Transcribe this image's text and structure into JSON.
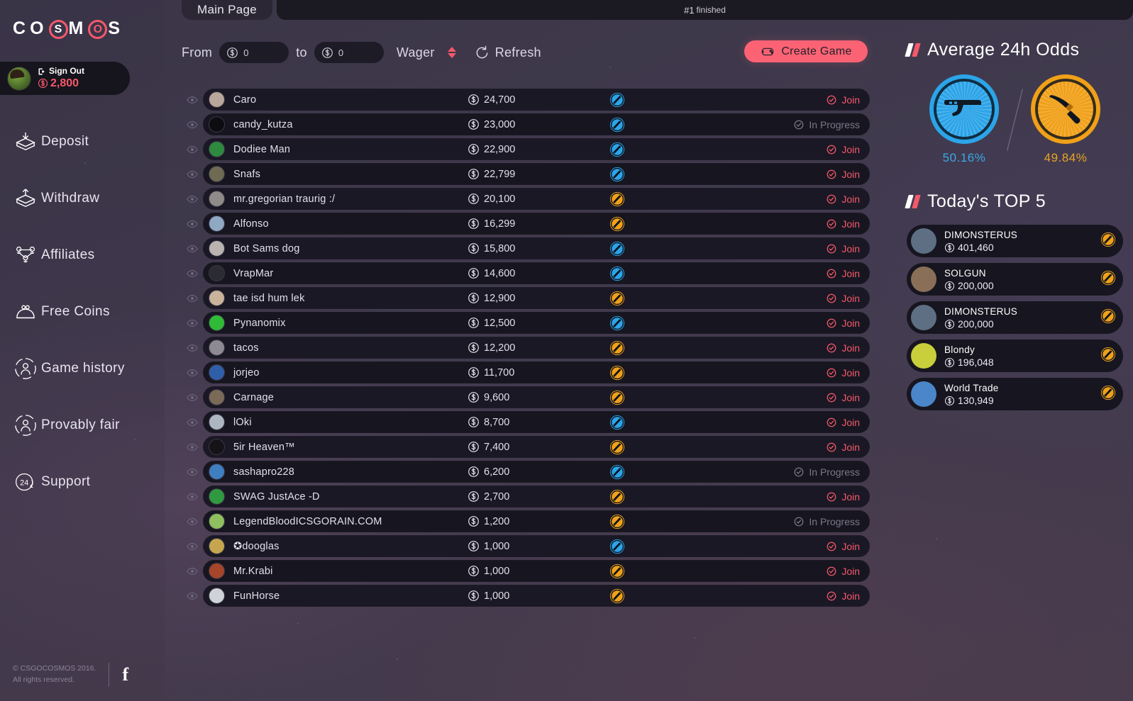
{
  "brand": {
    "name_parts": [
      "C",
      "O",
      "S",
      "M",
      "O",
      "S"
    ],
    "accent": "#f4596b"
  },
  "user": {
    "signout_label": "Sign Out",
    "balance": "2,800"
  },
  "sidebar": {
    "items": [
      {
        "label": "Deposit",
        "icon": "deposit-icon"
      },
      {
        "label": "Withdraw",
        "icon": "withdraw-icon"
      },
      {
        "label": "Affiliates",
        "icon": "affiliates-icon"
      },
      {
        "label": "Free Coins",
        "icon": "free-coins-icon"
      },
      {
        "label": "Game history",
        "icon": "game-history-icon"
      },
      {
        "label": "Provably fair",
        "icon": "provably-fair-icon"
      },
      {
        "label": "Support",
        "icon": "support-24-icon"
      }
    ],
    "footer_line1": "© CSGOCOSMOS 2016.",
    "footer_line2": "All rights reserved.",
    "facebook": "f"
  },
  "tabs": {
    "main_label": "Main Page",
    "status_number": "#1",
    "status_text": "finished"
  },
  "filters": {
    "from_label": "From",
    "from_value": "0",
    "to_label": "to",
    "to_value": "0",
    "wager_label": "Wager",
    "refresh_label": "Refresh",
    "create_game_label": "Create Game"
  },
  "games": [
    {
      "name": "Caro",
      "amount": "24,700",
      "side": "t",
      "action": "Join",
      "state": "join",
      "avatar": "#b8a79a"
    },
    {
      "name": "candy_kutza",
      "amount": "23,000",
      "side": "t",
      "action": "In Progress",
      "state": "progress",
      "avatar": "#0d0d11"
    },
    {
      "name": "Dodiee Man",
      "amount": "22,900",
      "side": "t",
      "action": "Join",
      "state": "join",
      "avatar": "#2d8a3e"
    },
    {
      "name": "Snafs",
      "amount": "22,799",
      "side": "t",
      "action": "Join",
      "state": "join",
      "avatar": "#6f6a52"
    },
    {
      "name": "mr.gregorian traurig :/",
      "amount": "20,100",
      "side": "ct",
      "action": "Join",
      "state": "join",
      "avatar": "#8e8b88"
    },
    {
      "name": "Alfonso",
      "amount": "16,299",
      "side": "ct",
      "action": "Join",
      "state": "join",
      "avatar": "#8fa8c4"
    },
    {
      "name": "Bot Sams dog",
      "amount": "15,800",
      "side": "t",
      "action": "Join",
      "state": "join",
      "avatar": "#b9b4b0"
    },
    {
      "name": "VrapMar",
      "amount": "14,600",
      "side": "t",
      "action": "Join",
      "state": "join",
      "avatar": "#2b2b33"
    },
    {
      "name": "tae isd hum lek",
      "amount": "12,900",
      "side": "ct",
      "action": "Join",
      "state": "join",
      "avatar": "#c9b39b"
    },
    {
      "name": "Pynanomix",
      "amount": "12,500",
      "side": "t",
      "action": "Join",
      "state": "join",
      "avatar": "#2fbb37"
    },
    {
      "name": "tacos",
      "amount": "12,200",
      "side": "ct",
      "action": "Join",
      "state": "join",
      "avatar": "#8d8a92"
    },
    {
      "name": "jorjeo",
      "amount": "11,700",
      "side": "ct",
      "action": "Join",
      "state": "join",
      "avatar": "#2f5fa8"
    },
    {
      "name": "Carnage",
      "amount": "9,600",
      "side": "ct",
      "action": "Join",
      "state": "join",
      "avatar": "#7b6a58"
    },
    {
      "name": "lOki",
      "amount": "8,700",
      "side": "t",
      "action": "Join",
      "state": "join",
      "avatar": "#aeb6c2"
    },
    {
      "name": "5ir Heaven™",
      "amount": "7,400",
      "side": "ct",
      "action": "Join",
      "state": "join",
      "avatar": "#151318"
    },
    {
      "name": "sashapro228",
      "amount": "6,200",
      "side": "t",
      "action": "In Progress",
      "state": "progress",
      "avatar": "#3f7fbf"
    },
    {
      "name": "SWAG JustAce -D",
      "amount": "2,700",
      "side": "ct",
      "action": "Join",
      "state": "join",
      "avatar": "#2f9a3f"
    },
    {
      "name": "LegendBloodICSGORAIN.COM",
      "amount": "1,200",
      "side": "ct",
      "action": "In Progress",
      "state": "progress",
      "avatar": "#8fbf5f"
    },
    {
      "name": "✪dooglas",
      "amount": "1,000",
      "side": "t",
      "action": "Join",
      "state": "join",
      "avatar": "#c5a64e"
    },
    {
      "name": "Mr.Krabi",
      "amount": "1,000",
      "side": "ct",
      "action": "Join",
      "state": "join",
      "avatar": "#a5452a"
    },
    {
      "name": "FunHorse",
      "amount": "1,000",
      "side": "ct",
      "action": "Join",
      "state": "join",
      "avatar": "#cfd3d8"
    }
  ],
  "odds": {
    "title": "Average 24h Odds",
    "t_label": "50.16%",
    "ct_label": "49.84%",
    "t_color": "#2ca4e8",
    "ct_color": "#f0a019"
  },
  "top5": {
    "title": "Today's TOP 5",
    "rows": [
      {
        "name": "DIMONSTERUS",
        "amount": "401,460",
        "avatar": "#5e6f84"
      },
      {
        "name": "SOLGUN",
        "amount": "200,000",
        "avatar": "#8a6f58"
      },
      {
        "name": "DIMONSTERUS",
        "amount": "200,000",
        "avatar": "#5e6f84"
      },
      {
        "name": "Blondy",
        "amount": "196,048",
        "avatar": "#c8cf3a"
      },
      {
        "name": "World Trade",
        "amount": "130,949",
        "avatar": "#4a86c9"
      }
    ]
  },
  "chart_data": {
    "type": "pie",
    "title": "Average 24h Odds",
    "categories": [
      "T (pistol)",
      "CT (knife)"
    ],
    "values": [
      50.16,
      49.84
    ],
    "labels": [
      "50.16%",
      "49.84%"
    ],
    "colors": [
      "#2ca4e8",
      "#f0a019"
    ],
    "ylabel": "",
    "xlabel": "",
    "legend": "below-slices"
  }
}
